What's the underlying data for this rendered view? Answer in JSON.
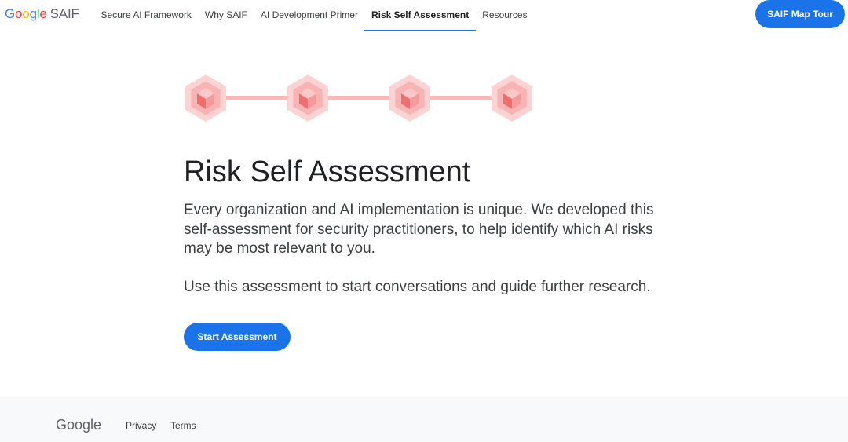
{
  "header": {
    "logo": {
      "letters": [
        "G",
        "o",
        "o",
        "g",
        "l",
        "e"
      ],
      "product": "SAIF"
    },
    "nav": [
      {
        "label": "Secure AI Framework",
        "active": false
      },
      {
        "label": "Why SAIF",
        "active": false
      },
      {
        "label": "AI Development Primer",
        "active": false
      },
      {
        "label": "Risk Self Assessment",
        "active": true
      },
      {
        "label": "Resources",
        "active": false
      }
    ],
    "cta_label": "SAIF Map Tour"
  },
  "main": {
    "graphic_icon": "connected-hexagon-cubes-icon",
    "title": "Risk Self Assessment",
    "intro": "Every organization and AI implementation is unique. We developed this self-assessment for security practitioners, to help identify which AI risks may be most relevant to you.",
    "intro_secondary": "Use this assessment to start conversations and guide further research.",
    "start_label": "Start Assessment"
  },
  "footer": {
    "logo_text": "Google",
    "links": [
      "Privacy",
      "Terms"
    ]
  },
  "colors": {
    "accent": "#1a73e8",
    "graphic": "#f4a7a7",
    "text": "#202124",
    "footer_bg": "#f8f9fa"
  }
}
